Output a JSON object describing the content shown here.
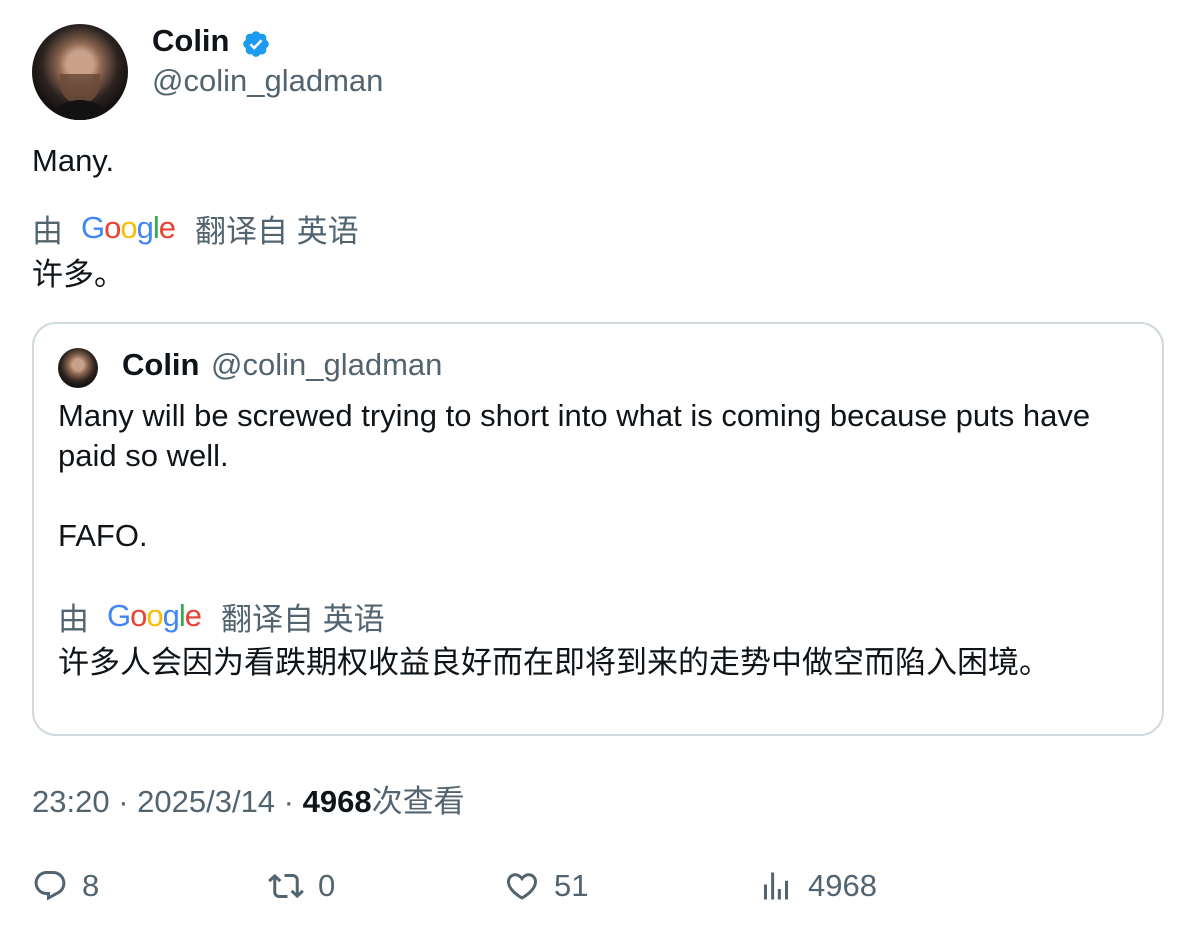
{
  "author": {
    "name": "Colin",
    "handle": "@colin_gladman",
    "verified": true
  },
  "tweet": {
    "text": "Many.",
    "translation_by": "由",
    "translation_provider": "Google",
    "translation_note": "翻译自 英语",
    "translated_text": "许多。"
  },
  "quoted": {
    "name": "Colin",
    "handle": "@colin_gladman",
    "text": "Many will be screwed trying to short into what is coming because puts have paid so well.\n\nFAFO.",
    "translation_by": "由",
    "translation_provider": "Google",
    "translation_note": "翻译自 英语",
    "translated_text": "许多人会因为看跌期权收益良好而在即将到来的走势中做空而陷入困境。"
  },
  "meta": {
    "time": "23:20",
    "date": "2025/3/14",
    "views_count": "4968",
    "views_label": "次查看"
  },
  "actions": {
    "replies": "8",
    "reposts": "0",
    "likes": "51",
    "views": "4968"
  },
  "colors": {
    "verified": "#1d9bf0",
    "secondary_text": "#536471",
    "border": "#cfd9de"
  },
  "icons": [
    "verified-badge-icon",
    "reply-icon",
    "repost-icon",
    "like-icon",
    "views-icon"
  ]
}
